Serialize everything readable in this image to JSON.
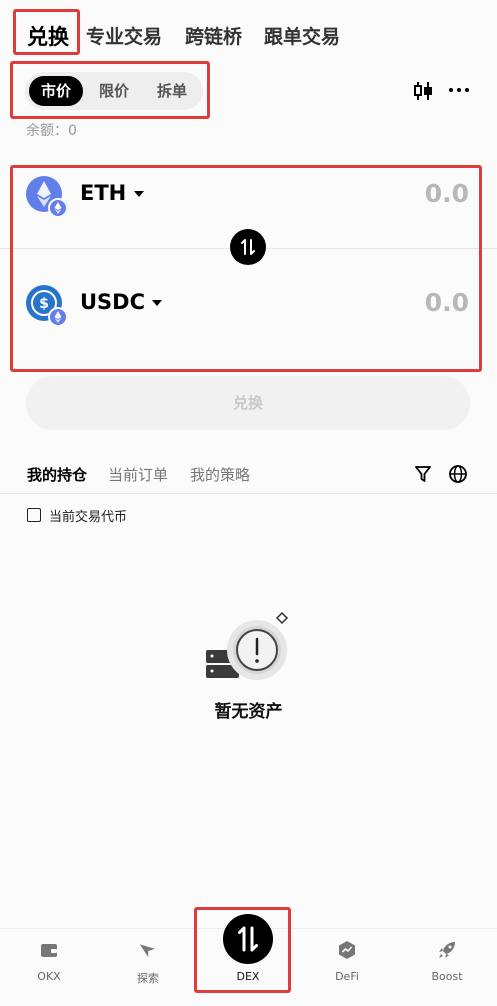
{
  "top_tabs": [
    {
      "label": "兑换",
      "active": true
    },
    {
      "label": "专业交易",
      "active": false
    },
    {
      "label": "跨链桥",
      "active": false
    },
    {
      "label": "跟单交易",
      "active": false
    }
  ],
  "order_types": [
    {
      "label": "市价",
      "active": true
    },
    {
      "label": "限价",
      "active": false
    },
    {
      "label": "拆单",
      "active": false
    }
  ],
  "balance_text": "余额：0",
  "from_token": {
    "symbol": "ETH",
    "amount": "0.0",
    "icon": "ethereum-icon"
  },
  "to_token": {
    "symbol": "USDC",
    "amount": "0.0",
    "icon": "usdc-icon"
  },
  "swap_button_label": "兑换",
  "portfolio_tabs": [
    {
      "label": "我的持仓",
      "active": true
    },
    {
      "label": "当前订单",
      "active": false
    },
    {
      "label": "我的策略",
      "active": false
    }
  ],
  "filter_checkbox_label": "当前交易代币",
  "empty_state_text": "暂无资产",
  "bottom_nav": [
    {
      "label": "OKX",
      "icon": "wallet-icon"
    },
    {
      "label": "探索",
      "icon": "compass-icon"
    },
    {
      "label": "DEX",
      "icon": "swap-icon",
      "active": true
    },
    {
      "label": "DeFi",
      "icon": "chart-icon"
    },
    {
      "label": "Boost",
      "icon": "rocket-icon"
    }
  ],
  "colors": {
    "accent": "#000000",
    "highlight_box": "#e03b3b",
    "eth_blue": "#627eea",
    "usdc_blue": "#2775ca"
  }
}
